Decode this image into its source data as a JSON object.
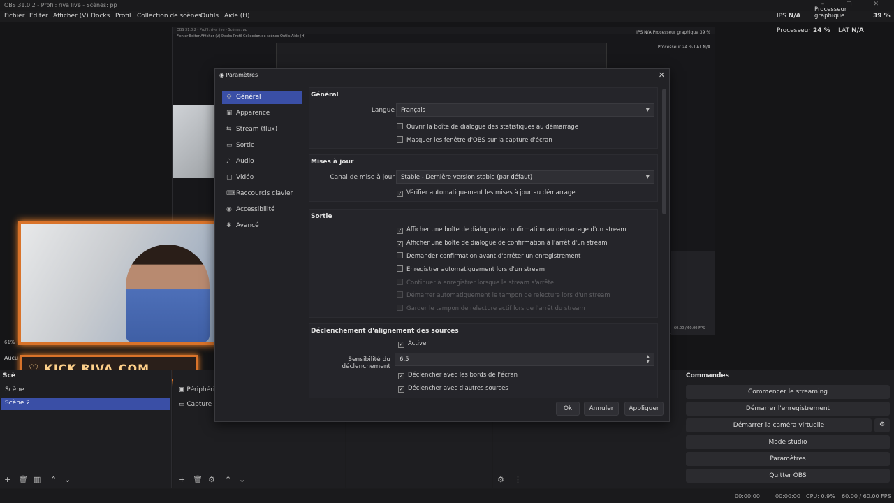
{
  "window": {
    "title": "OBS 31.0.2 - Profil: riva live - Scènes: pp",
    "controls": "–  ▢  ✕"
  },
  "menu": [
    "Fichier",
    "Editer",
    "Afficher (V)",
    "Docks",
    "Profil",
    "Collection de scènes",
    "Outils",
    "Aide (H)"
  ],
  "stats": {
    "ips_label": "IPS",
    "ips_value": "N/A",
    "gpu_label": "Processeur graphique",
    "gpu_value": "39 %",
    "cpu_label": "Processeur",
    "cpu_value": "24 %",
    "lat_label": "LAT",
    "lat_value": "N/A"
  },
  "nested": {
    "title": "OBS 31.0.2 - Profil: riva live - Scènes: pp",
    "menu": "Fichier   Editer   Afficher (V)   Docks   Profil   Collection de scènes   Outils   Aide (H)",
    "stats1": "IPS N/A   Processeur graphique 39 %",
    "stats2": "Processeur 24 %   LAT N/A",
    "fps": "60.00 / 60.00 FPS"
  },
  "overlay": {
    "kick": "♡.KICK RIVA.COM",
    "pct": "61%",
    "aucun": "Aucu"
  },
  "scenes": {
    "header": "Scè",
    "items": [
      "Scène",
      "Scène 2"
    ]
  },
  "sources": {
    "items": [
      "Périphéri",
      "Capture d"
    ]
  },
  "commands": {
    "header": "Commandes",
    "buttons": [
      "Commencer le streaming",
      "Démarrer l'enregistrement",
      "Démarrer la caméra virtuelle",
      "Mode studio",
      "Paramètres",
      "Quitter OBS"
    ]
  },
  "statusbar": {
    "t1": "00:00:00",
    "t2": "00:00:00",
    "cpu": "CPU: 0.9%",
    "fps": "60.00 / 60.00 FPS"
  },
  "dialog": {
    "title": "Paramètres",
    "sidebar": [
      {
        "label": "Général",
        "icon": "⚙"
      },
      {
        "label": "Apparence",
        "icon": "▣"
      },
      {
        "label": "Stream (flux)",
        "icon": "⇆"
      },
      {
        "label": "Sortie",
        "icon": "▭"
      },
      {
        "label": "Audio",
        "icon": "♪"
      },
      {
        "label": "Vidéo",
        "icon": "▢"
      },
      {
        "label": "Raccourcis clavier",
        "icon": "⌨"
      },
      {
        "label": "Accessibilité",
        "icon": "◉"
      },
      {
        "label": "Avancé",
        "icon": "✱"
      }
    ],
    "general": {
      "header": "Général",
      "language_label": "Langue",
      "language_value": "Français",
      "cb1": "Ouvrir la boîte de dialogue des statistiques au démarrage",
      "cb2": "Masquer les fenêtre d'OBS sur la capture d'écran"
    },
    "updates": {
      "header": "Mises à jour",
      "channel_label": "Canal de mise à jour",
      "channel_value": "Stable - Dernière version stable (par défaut)",
      "cb1": "Vérifier automatiquement les mises à jour au démarrage"
    },
    "output": {
      "header": "Sortie",
      "cb1": "Afficher une boîte de dialogue de confirmation au démarrage d'un stream",
      "cb2": "Afficher une boîte de dialogue de confirmation à l'arrêt d'un stream",
      "cb3": "Demander confirmation avant d'arrêter un enregistrement",
      "cb4": "Enregistrer automatiquement lors d'un stream",
      "cb5": "Continuer à enregistrer lorsque le stream s'arrête",
      "cb6": "Démarrer automatiquement le tampon de relecture lors d'un stream",
      "cb7": "Garder le tampon de relecture actif lors de l'arrêt du stream"
    },
    "snapping": {
      "header": "Déclenchement d'alignement des sources",
      "cb1": "Activer",
      "sens_label": "Sensibilité du déclenchement",
      "sens_value": "6,5",
      "cb2": "Déclencher avec les bords de l'écran",
      "cb3": "Déclencher avec d'autres sources"
    },
    "buttons": {
      "ok": "Ok",
      "cancel": "Annuler",
      "apply": "Appliquer"
    }
  }
}
